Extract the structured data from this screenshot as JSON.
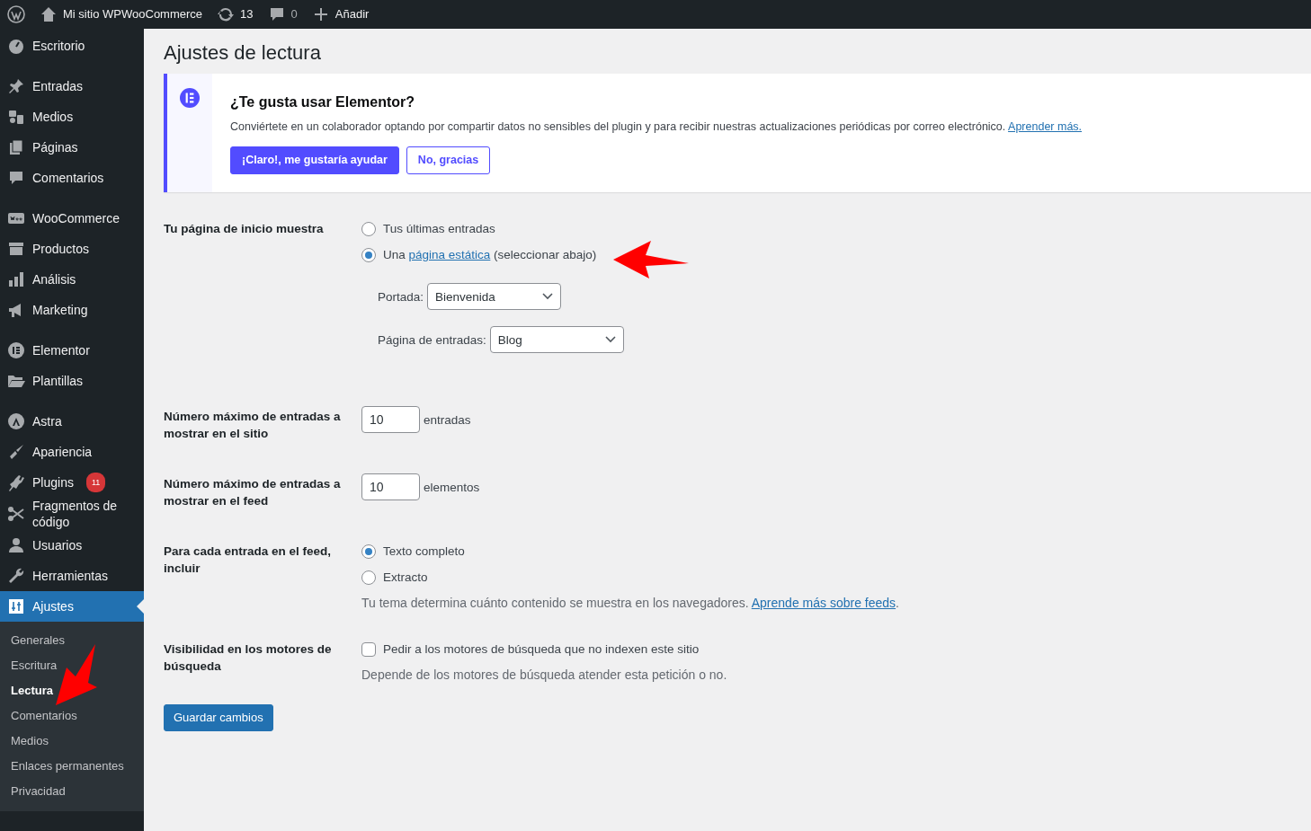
{
  "topbar": {
    "site": "Mi sitio WPWooCommerce",
    "updates": "13",
    "comments": "0",
    "new": "Añadir"
  },
  "sidebar": {
    "groups": [
      {
        "items": [
          {
            "label": "Escritorio",
            "selected": false
          }
        ]
      },
      {
        "items": [
          {
            "label": "Entradas",
            "selected": false
          },
          {
            "label": "Medios",
            "selected": false
          },
          {
            "label": "Páginas",
            "selected": false
          },
          {
            "label": "Comentarios",
            "selected": false
          }
        ]
      },
      {
        "items": [
          {
            "label": "WooCommerce",
            "selected": false
          },
          {
            "label": "Productos",
            "selected": false
          },
          {
            "label": "Análisis",
            "selected": false
          },
          {
            "label": "Marketing",
            "selected": false
          }
        ]
      },
      {
        "items": [
          {
            "label": "Elementor",
            "selected": false
          },
          {
            "label": "Plantillas",
            "selected": false
          }
        ]
      },
      {
        "items": [
          {
            "label": "Astra",
            "selected": false
          },
          {
            "label": "Apariencia",
            "selected": false
          },
          {
            "label": "Plugins",
            "badge": "11",
            "selected": false
          },
          {
            "label": "Fragmentos de código",
            "selected": false
          },
          {
            "label": "Usuarios",
            "selected": false
          },
          {
            "label": "Herramientas",
            "selected": false
          },
          {
            "label": "Ajustes",
            "selected": true
          }
        ]
      }
    ],
    "submenu": [
      {
        "label": "Generales",
        "selected": false
      },
      {
        "label": "Escritura",
        "selected": false
      },
      {
        "label": "Lectura",
        "selected": true
      },
      {
        "label": "Comentarios",
        "selected": false
      },
      {
        "label": "Medios",
        "selected": false
      },
      {
        "label": "Enlaces permanentes",
        "selected": false
      },
      {
        "label": "Privacidad",
        "selected": false
      }
    ]
  },
  "page_title": "Ajustes de lectura",
  "notice": {
    "title": "¿Te gusta usar Elementor?",
    "text": "Conviértete en un colaborador optando por compartir datos no sensibles del plugin y para recibir nuestras actualizaciones periódicas por correo electrónico.",
    "link": "Aprender más.",
    "buttons": [
      {
        "label": "¡Claro!, me gustaría ayudar",
        "kind": "primary"
      },
      {
        "label": "No, gracias",
        "kind": "outline"
      }
    ]
  },
  "settings": [
    {
      "kind": "radios",
      "label": "Tu página de inicio muestra",
      "options": [
        {
          "text": "Tus últimas entradas",
          "selected": false
        },
        {
          "text": "Una ",
          "link": "página estática",
          "after": " (seleccionar abajo)",
          "selected": true
        }
      ],
      "selects": [
        {
          "label": "Portada:",
          "value": "Bienvenida"
        },
        {
          "label": "Página de entradas:",
          "value": "Blog"
        }
      ]
    },
    {
      "kind": "number",
      "label": "Número máximo de entradas a mostrar en el sitio",
      "value": "10",
      "unit": "entradas"
    },
    {
      "kind": "number",
      "label": "Número máximo de entradas a mostrar en el feed",
      "value": "10",
      "unit": "elementos"
    },
    {
      "kind": "radios",
      "label": "Para cada entrada en el feed, incluir",
      "options": [
        {
          "text": "Texto completo",
          "selected": true
        },
        {
          "text": "Extracto",
          "selected": false
        }
      ],
      "note": "Tu tema determina cuánto contenido se muestra en los navegadores. ",
      "note_link": "Aprende más sobre feeds",
      "note_after": "."
    },
    {
      "kind": "checkbox",
      "label": "Visibilidad en los motores de búsqueda",
      "text": "Pedir a los motores de búsqueda que no indexen este sitio",
      "checked": false,
      "note": "Depende de los motores de búsqueda atender esta petición o no."
    }
  ],
  "save_button": "Guardar cambios"
}
